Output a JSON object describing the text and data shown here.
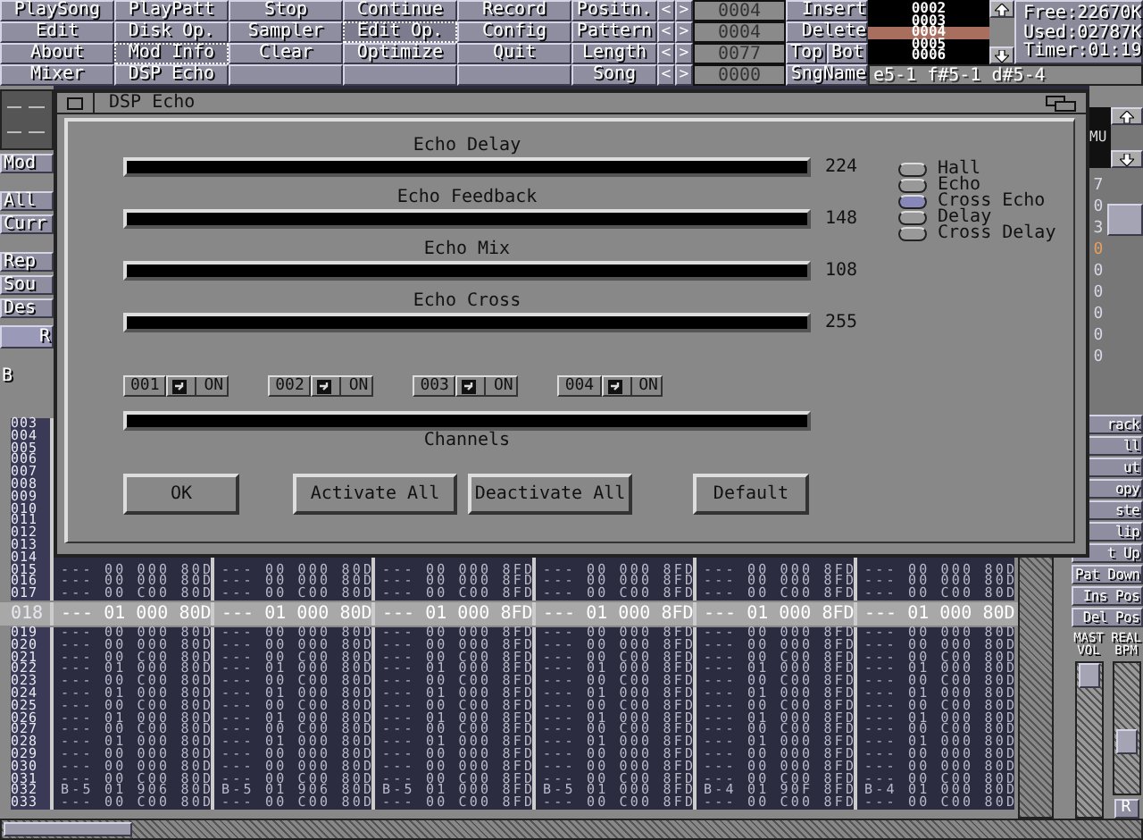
{
  "menu_buttons": [
    {
      "label": "PlaySong",
      "active": false
    },
    {
      "label": "PlayPatt",
      "active": false
    },
    {
      "label": "Stop",
      "active": false
    },
    {
      "label": "Continue",
      "active": false
    },
    {
      "label": "Record",
      "active": false
    },
    {
      "label": "Edit",
      "active": false
    },
    {
      "label": "Disk Op.",
      "active": false
    },
    {
      "label": "Sampler",
      "active": false
    },
    {
      "label": "Edit Op.",
      "active": true
    },
    {
      "label": "Config",
      "active": false
    },
    {
      "label": "About",
      "active": false
    },
    {
      "label": "Mod Info",
      "active": true
    },
    {
      "label": "Clear",
      "active": false
    },
    {
      "label": "Optimize",
      "active": false
    },
    {
      "label": "Quit",
      "active": false
    },
    {
      "label": "Mixer",
      "active": false
    },
    {
      "label": "DSP Echo",
      "active": false
    }
  ],
  "song_panel": {
    "rows": [
      {
        "label": "Positn.",
        "value": "0004",
        "action": "Insert"
      },
      {
        "label": "Pattern",
        "value": "0004",
        "action": "Delete"
      },
      {
        "label": "Length",
        "value": "0077",
        "actions": [
          "Top",
          "Bot"
        ]
      },
      {
        "label": "Song",
        "value": "0000",
        "action": "SngName"
      }
    ],
    "decrement": "<",
    "increment": ">",
    "position_list": [
      {
        "text": "0002",
        "selected": false
      },
      {
        "text": "0003",
        "selected": false
      },
      {
        "text": "0004",
        "selected": true
      },
      {
        "text": "0005",
        "selected": false
      },
      {
        "text": "0006",
        "selected": false
      }
    ],
    "song_name": "e5-1 f#5-1 d#5-4"
  },
  "info": [
    "Free:22670K",
    "Used:02787K",
    "Timer:01:19"
  ],
  "left_panel": [
    {
      "label": "Mod",
      "kind": "button"
    },
    {
      "label": "All",
      "kind": "button"
    },
    {
      "label": "Curr",
      "kind": "button"
    },
    {
      "label": "Rep",
      "kind": "button"
    },
    {
      "label": "Sou",
      "kind": "button"
    },
    {
      "label": "Des",
      "kind": "button"
    },
    {
      "label": "R",
      "kind": "bar"
    },
    {
      "label": "B",
      "kind": "plain"
    }
  ],
  "right_panel": {
    "display": "MU",
    "digits": [
      {
        "text": "7",
        "color": "#d8d8e8"
      },
      {
        "text": "0",
        "color": "#d8d8e8"
      },
      {
        "text": "3",
        "color": "#d8d8e8"
      },
      {
        "text": "0",
        "color": "#e8a060"
      },
      {
        "text": "0",
        "color": "#d8d8e8"
      },
      {
        "text": "0",
        "color": "#d8d8e8"
      },
      {
        "text": "0",
        "color": "#d8d8e8"
      },
      {
        "text": "0",
        "color": "#d8d8e8"
      },
      {
        "text": "0",
        "color": "#d8d8e8"
      }
    ],
    "buttons": [
      "rack",
      "ll",
      "ut",
      "opy",
      "ste",
      "lip",
      "t Up",
      "Pat Down",
      "Ins Pos",
      "Del Pos"
    ],
    "sliders": [
      {
        "label": "MAST VOL",
        "level": 1
      },
      {
        "label": "REAL BPM",
        "level": 0.38
      }
    ],
    "reset": "R"
  },
  "pattern": {
    "rows": [
      {
        "num": "003",
        "selected": false
      },
      {
        "num": "004",
        "selected": false
      },
      {
        "num": "005",
        "selected": false
      },
      {
        "num": "006",
        "selected": false
      },
      {
        "num": "007",
        "selected": false
      },
      {
        "num": "008",
        "selected": false
      },
      {
        "num": "009",
        "selected": false
      },
      {
        "num": "010",
        "selected": false
      },
      {
        "num": "011",
        "selected": false
      },
      {
        "num": "012",
        "selected": false
      },
      {
        "num": "013",
        "selected": false
      },
      {
        "num": "014",
        "selected": false
      },
      {
        "num": "015",
        "selected": false,
        "cells": [
          "--- 00 000 80D",
          "--- 00 000 80D",
          "--- 00 000 8FD",
          "--- 00 000 8FD",
          "--- 00 000 8FD",
          "--- 00 000 80D"
        ]
      },
      {
        "num": "016",
        "selected": false,
        "cells": [
          "--- 00 000 80D",
          "--- 00 000 80D",
          "--- 00 000 8FD",
          "--- 00 000 8FD",
          "--- 00 000 8FD",
          "--- 00 000 80D"
        ]
      },
      {
        "num": "017",
        "selected": false,
        "cells": [
          "--- 00 C00 80D",
          "--- 00 C00 80D",
          "--- 00 C00 8FD",
          "--- 00 C00 8FD",
          "--- 00 C00 8FD",
          "--- 00 C00 80D"
        ]
      },
      {
        "num": "018",
        "selected": true,
        "cells": [
          "--- 01 000 80D",
          "--- 01 000 80D",
          "--- 01 000 8FD",
          "--- 01 000 8FD",
          "--- 01 000 8FD",
          "--- 01 000 80D"
        ]
      },
      {
        "num": "019",
        "selected": false,
        "cells": [
          "--- 00 000 80D",
          "--- 00 000 80D",
          "--- 00 000 8FD",
          "--- 00 000 8FD",
          "--- 00 000 8FD",
          "--- 00 000 80D"
        ]
      },
      {
        "num": "020",
        "selected": false,
        "cells": [
          "--- 00 000 80D",
          "--- 00 000 80D",
          "--- 00 000 8FD",
          "--- 00 000 8FD",
          "--- 00 000 8FD",
          "--- 00 000 80D"
        ]
      },
      {
        "num": "021",
        "selected": false,
        "cells": [
          "--- 00 C00 80D",
          "--- 00 C00 80D",
          "--- 00 C00 8FD",
          "--- 00 C00 8FD",
          "--- 00 C00 8FD",
          "--- 00 C00 80D"
        ]
      },
      {
        "num": "022",
        "selected": false,
        "cells": [
          "--- 01 000 80D",
          "--- 01 000 80D",
          "--- 01 000 8FD",
          "--- 01 000 8FD",
          "--- 01 000 8FD",
          "--- 01 000 80D"
        ]
      },
      {
        "num": "023",
        "selected": false,
        "cells": [
          "--- 00 C00 80D",
          "--- 00 C00 80D",
          "--- 00 C00 8FD",
          "--- 00 C00 8FD",
          "--- 00 C00 8FD",
          "--- 00 C00 80D"
        ]
      },
      {
        "num": "024",
        "selected": false,
        "cells": [
          "--- 01 000 80D",
          "--- 01 000 80D",
          "--- 01 000 8FD",
          "--- 01 000 8FD",
          "--- 01 000 8FD",
          "--- 01 000 80D"
        ]
      },
      {
        "num": "025",
        "selected": false,
        "cells": [
          "--- 00 C00 80D",
          "--- 00 C00 80D",
          "--- 00 C00 8FD",
          "--- 00 C00 8FD",
          "--- 00 C00 8FD",
          "--- 00 C00 80D"
        ]
      },
      {
        "num": "026",
        "selected": false,
        "cells": [
          "--- 01 000 80D",
          "--- 01 000 80D",
          "--- 01 000 8FD",
          "--- 01 000 8FD",
          "--- 01 000 8FD",
          "--- 01 000 80D"
        ]
      },
      {
        "num": "027",
        "selected": false,
        "cells": [
          "--- 00 C00 80D",
          "--- 00 C00 80D",
          "--- 00 C00 8FD",
          "--- 00 C00 8FD",
          "--- 00 C00 8FD",
          "--- 00 C00 80D"
        ]
      },
      {
        "num": "028",
        "selected": false,
        "cells": [
          "--- 01 000 80D",
          "--- 01 000 80D",
          "--- 01 000 8FD",
          "--- 01 000 8FD",
          "--- 01 000 8FD",
          "--- 01 000 80D"
        ]
      },
      {
        "num": "029",
        "selected": false,
        "cells": [
          "--- 00 000 80D",
          "--- 00 000 80D",
          "--- 00 000 8FD",
          "--- 00 000 8FD",
          "--- 00 000 8FD",
          "--- 00 000 80D"
        ]
      },
      {
        "num": "030",
        "selected": false,
        "cells": [
          "--- 00 000 80D",
          "--- 00 000 80D",
          "--- 00 000 8FD",
          "--- 00 000 8FD",
          "--- 00 000 8FD",
          "--- 00 000 80D"
        ]
      },
      {
        "num": "031",
        "selected": false,
        "cells": [
          "--- 00 C00 80D",
          "--- 00 C00 80D",
          "--- 00 C00 8FD",
          "--- 00 C00 8FD",
          "--- 00 C00 8FD",
          "--- 00 C00 80D"
        ]
      },
      {
        "num": "032",
        "selected": false,
        "cells": [
          "B-5 01 906 80D",
          "B-5 01 906 80D",
          "B-5 01 000 8FD",
          "B-5 01 000 8FD",
          "B-4 01 90F 8FD",
          "B-4 01 000 80D"
        ]
      },
      {
        "num": "033",
        "selected": false,
        "cells": [
          "--- 00 C00 80D",
          "--- 00 C00 80D",
          "--- 00 C00 8FD",
          "--- 00 C00 8FD",
          "--- 00 C00 8FD",
          "--- 00 C00 80D"
        ]
      }
    ]
  },
  "dialog": {
    "title": "DSP Echo",
    "sliders": [
      {
        "label": "Echo Delay",
        "reading": "224"
      },
      {
        "label": "Echo Feedback",
        "reading": "148"
      },
      {
        "label": "Echo Mix",
        "reading": "108"
      },
      {
        "label": "Echo Cross",
        "reading": "255"
      }
    ],
    "modes": [
      {
        "label": "Hall",
        "selected": false
      },
      {
        "label": "Echo",
        "selected": false
      },
      {
        "label": "Cross Echo",
        "selected": true
      },
      {
        "label": "Delay",
        "selected": false
      },
      {
        "label": "Cross Delay",
        "selected": false
      }
    ],
    "channels": [
      {
        "number": "001",
        "state": "ON"
      },
      {
        "number": "002",
        "state": "ON"
      },
      {
        "number": "003",
        "state": "ON"
      },
      {
        "number": "004",
        "state": "ON"
      }
    ],
    "channels_label": "Channels",
    "buttons": [
      "OK",
      "Activate All",
      "Deactivate All",
      "Default"
    ]
  }
}
